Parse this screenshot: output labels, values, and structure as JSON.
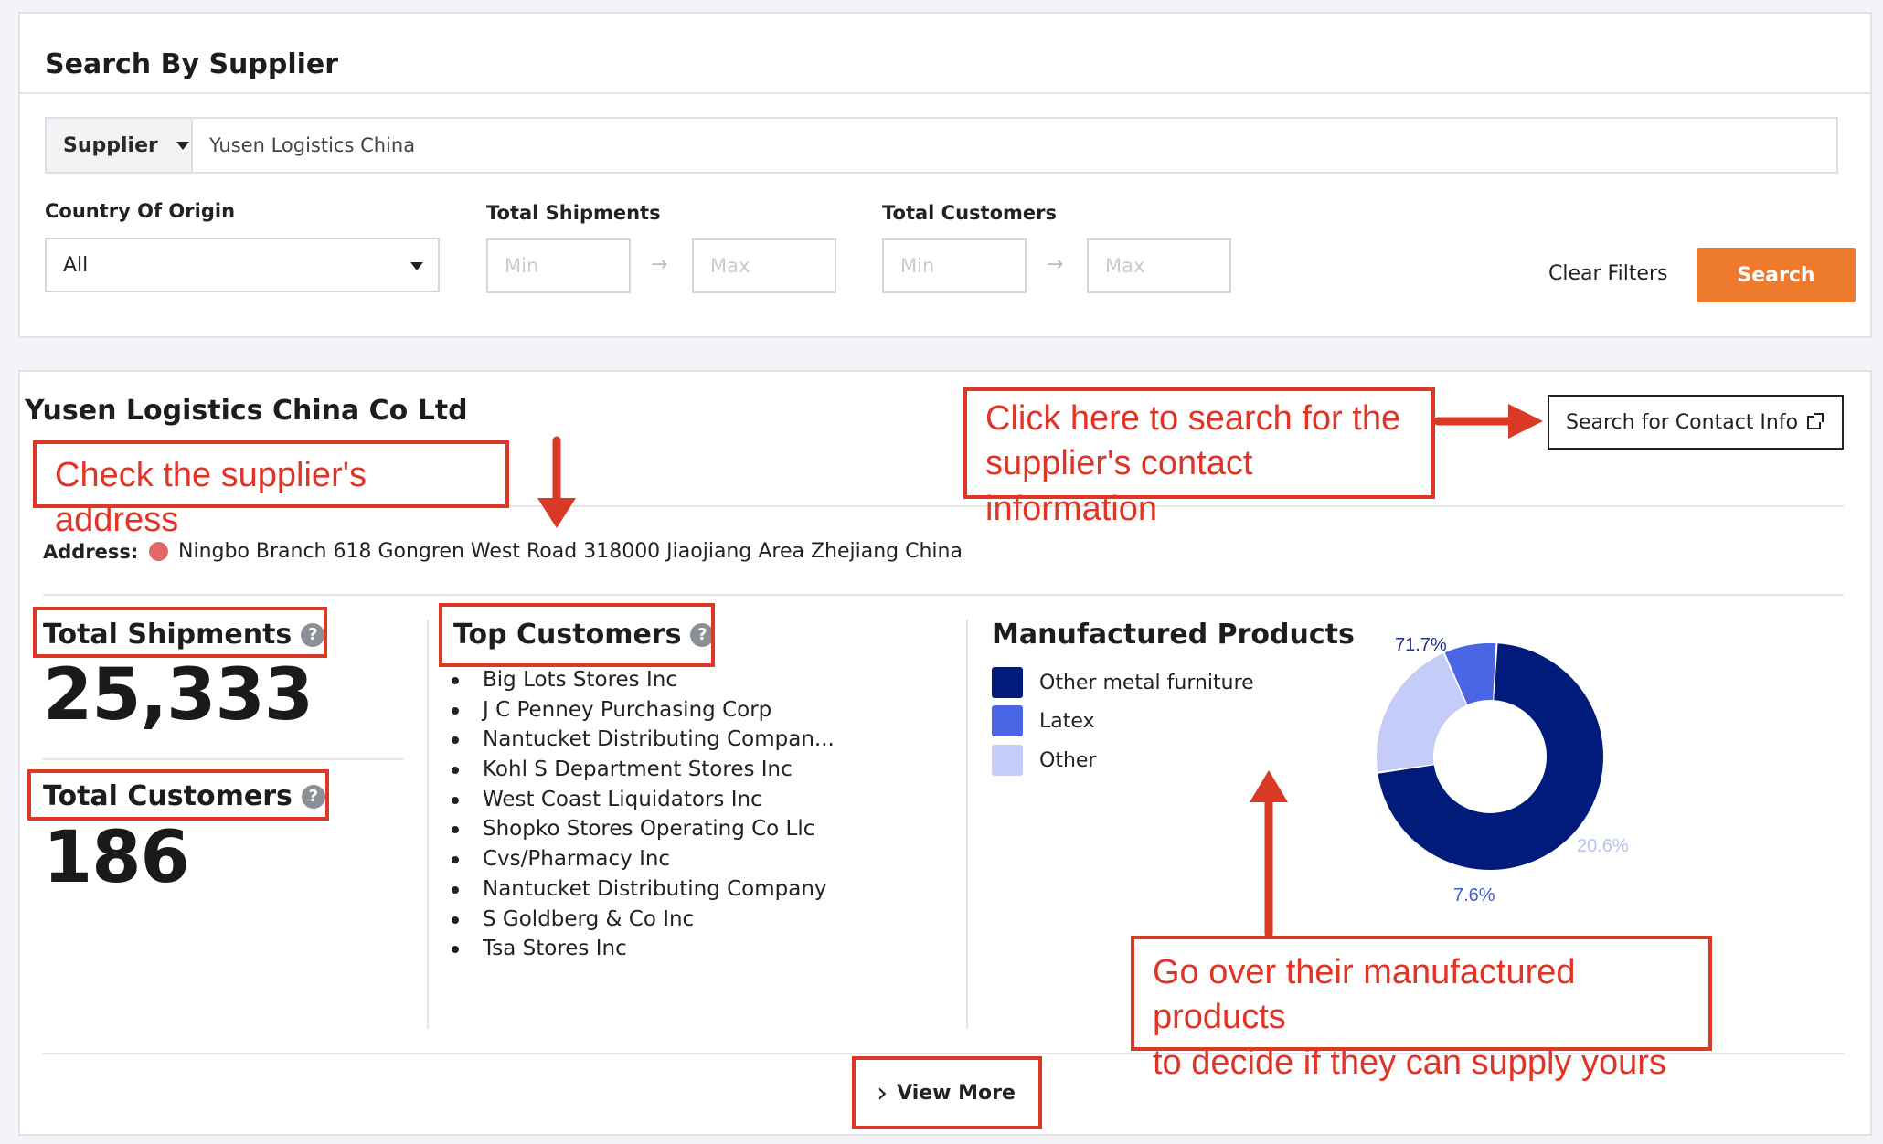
{
  "search": {
    "title": "Search By Supplier",
    "mode_label": "Supplier",
    "query": "Yusen Logistics China",
    "country_label": "Country Of Origin",
    "country_value": "All",
    "shipments_label": "Total Shipments",
    "customers_label": "Total Customers",
    "min_placeholder": "Min",
    "max_placeholder": "Max",
    "clear_label": "Clear Filters",
    "search_label": "Search"
  },
  "result": {
    "company": "Yusen Logistics China Co Ltd",
    "contact_button": "Search for Contact Info",
    "address_label": "Address:",
    "address": "Ningbo Branch 618 Gongren West Road 318000 Jiaojiang Area Zhejiang China",
    "total_shipments_label": "Total Shipments",
    "total_shipments": "25,333",
    "total_customers_label": "Total Customers",
    "total_customers": "186",
    "top_customers_title": "Top Customers",
    "top_customers": [
      "Big Lots Stores Inc",
      "J C Penney Purchasing Corp",
      "Nantucket Distributing Compan...",
      "Kohl S Department Stores Inc",
      "West Coast Liquidators Inc",
      "Shopko Stores Operating Co Llc",
      "Cvs/Pharmacy Inc",
      "Nantucket Distributing Company",
      "S Goldberg & Co Inc",
      "Tsa Stores Inc"
    ],
    "products_title": "Manufactured Products",
    "view_more": "View More"
  },
  "chart_data": {
    "type": "pie",
    "categories": [
      "Other metal furniture",
      "Latex",
      "Other"
    ],
    "values": [
      71.7,
      7.6,
      20.6
    ],
    "labels": [
      "71.7%",
      "7.6%",
      "20.6%"
    ],
    "colors": [
      "#001b7a",
      "#4a66e6",
      "#c4ccf7"
    ]
  },
  "annotations": {
    "address": "Check the supplier's address",
    "contact_line1": "Click here to search for the",
    "contact_line2": "supplier's contact information",
    "products_line1": "Go over their manufactured products",
    "products_line2": "to decide if they can supply yours"
  },
  "icons": {
    "help": "?",
    "view_more_chevron": "›"
  },
  "colors": {
    "accent": "#ee7b2d",
    "annotation": "#d93a26",
    "address_flag": "#de4c4c"
  }
}
